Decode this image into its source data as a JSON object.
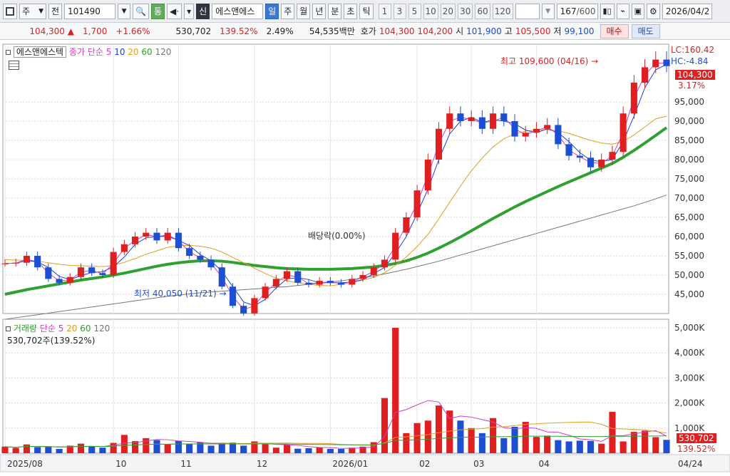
{
  "toolbar": {
    "type_label": "주",
    "code": "101490",
    "compare_label": "통",
    "credit_label": "신",
    "stock_name": "에스앤에스",
    "periods": [
      "일",
      "주",
      "월",
      "년",
      "분",
      "초",
      "틱"
    ],
    "intervals": [
      "1",
      "3",
      "5",
      "10",
      "20",
      "30",
      "60",
      "120"
    ],
    "count": "167",
    "count_total": "/600",
    "date": "2026/04/2"
  },
  "quote": {
    "price": "104,300",
    "change": "1,700",
    "change_pct": "+1.66%",
    "volume": "530,702",
    "volume_ratio": "139.52%",
    "turnover": "2.49%",
    "amount": "54,535백만",
    "bid_label": "호가",
    "ask_price": "104,300",
    "bid_price": "104,200",
    "open_label": "시",
    "open": "101,900",
    "high_label": "고",
    "high": "105,500",
    "low_label": "저",
    "low": "99,100",
    "buy_label": "매수",
    "sell_label": "매도"
  },
  "legend": {
    "name": "에스앤에스텍",
    "price_ma_label": "종가 단순",
    "vol_label": "거래량",
    "vol_ma_label": "단순",
    "ma_periods": [
      "5",
      "10",
      "20",
      "60",
      "120"
    ],
    "volume_value": "530,702주(139.52%)"
  },
  "indicators": {
    "lc": "LC:160.42",
    "hc": "HC:-4.84",
    "current_label": "104,300",
    "current_pct": "3.17%",
    "vol_current": "530,702",
    "vol_pct": "139.52%"
  },
  "annotations": {
    "high": "최고 109,600 (04/16)",
    "low": "최저 40,050 (11/21)",
    "dividend": "배당락(0.00%)"
  },
  "colors": {
    "up": "#e02020",
    "down": "#1f4fd1",
    "ma5": "#d040c0",
    "ma10": "#2040e0",
    "ma20": "#e0a020",
    "ma60": "#30a030",
    "ma120": "#777777"
  },
  "chart_data": {
    "type": "candlestick",
    "x_ticks": [
      "2025/08",
      "10",
      "11",
      "12",
      "2026/01",
      "02",
      "03",
      "04",
      "04/24"
    ],
    "price_axis": {
      "ylim": [
        40000,
        110000
      ],
      "ticks": [
        "45,000",
        "50,000",
        "55,000",
        "60,000",
        "65,000",
        "70,000",
        "75,000",
        "80,000",
        "85,000",
        "90,000",
        "95,000"
      ]
    },
    "volume_axis": {
      "ylim": [
        0,
        5000000
      ],
      "ticks": [
        "1,000K",
        "2,000K",
        "3,000K",
        "4,000K",
        "5,000K"
      ]
    },
    "series": [
      {
        "name": "종가",
        "values": [
          53000,
          53200,
          55000,
          52000,
          49000,
          48000,
          49500,
          52000,
          50500,
          50000,
          56000,
          58000,
          60000,
          61000,
          59000,
          61000,
          57000,
          55000,
          54000,
          52000,
          47000,
          42000,
          40050,
          44000,
          47000,
          49000,
          51000,
          48000,
          47500,
          48500,
          48000,
          47500,
          49000,
          50000,
          52000,
          54000,
          61000,
          65000,
          72000,
          80000,
          88000,
          92000,
          90000,
          91000,
          88000,
          92000,
          90000,
          86000,
          87000,
          88000,
          89000,
          84000,
          81000,
          80500,
          78000,
          80000,
          82000,
          92000,
          100000,
          104000,
          106000,
          104300
        ]
      },
      {
        "name": "20",
        "values": [
          54000,
          53900,
          53800,
          53600,
          53200,
          52800,
          52500,
          52400,
          52300,
          52200,
          52500,
          53300,
          54300,
          55400,
          56300,
          57200,
          57600,
          57700,
          57500,
          57000,
          56000,
          54600,
          53200,
          51800,
          50400,
          49200,
          48500,
          48000,
          47600,
          47300,
          47200,
          47600,
          48100,
          48700,
          49400,
          50600,
          52500,
          54700,
          57400,
          60600,
          64600,
          68900,
          73100,
          77100,
          80400,
          83300,
          85400,
          86700,
          87400,
          87700,
          87800,
          87500,
          86800,
          85900,
          85000,
          84300,
          84000,
          84700,
          86400,
          88500,
          90600,
          91300
        ]
      },
      {
        "name": "60",
        "values": [
          45000,
          45600,
          46200,
          46700,
          47200,
          47700,
          48200,
          48700,
          49100,
          49500,
          50000,
          50500,
          51100,
          51700,
          52300,
          52800,
          53200,
          53500,
          53700,
          53700,
          53600,
          53300,
          52900,
          52500,
          52200,
          51900,
          51700,
          51600,
          51500,
          51500,
          51500,
          51600,
          51700,
          51900,
          52100,
          52500,
          53000,
          53700,
          54600,
          55700,
          57000,
          58400,
          59900,
          61500,
          63100,
          64700,
          66200,
          67700,
          69100,
          70400,
          71700,
          73000,
          74200,
          75400,
          76600,
          77800,
          79000,
          80600,
          82400,
          84300,
          86300,
          88300
        ]
      },
      {
        "name": "120",
        "values": [
          38500,
          38900,
          39300,
          39700,
          40100,
          40500,
          40900,
          41300,
          41700,
          42100,
          42500,
          42900,
          43300,
          43700,
          44100,
          44500,
          44800,
          45100,
          45400,
          45600,
          45800,
          46000,
          46200,
          46400,
          46600,
          46800,
          47000,
          47300,
          47600,
          47900,
          48200,
          48500,
          48900,
          49300,
          49800,
          50300,
          50900,
          51500,
          52200,
          52900,
          53600,
          54400,
          55200,
          56000,
          56800,
          57600,
          58400,
          59200,
          60000,
          60800,
          61600,
          62400,
          63200,
          64000,
          64800,
          65600,
          66400,
          67200,
          68000,
          68900,
          69800,
          70800
        ]
      },
      {
        "name": "거래량",
        "values": [
          260000,
          210000,
          350000,
          240000,
          260000,
          170000,
          300000,
          380000,
          270000,
          220000,
          410000,
          730000,
          480000,
          600000,
          520000,
          360000,
          490000,
          380000,
          440000,
          300000,
          390000,
          420000,
          300000,
          470000,
          360000,
          220000,
          330000,
          180000,
          200000,
          230000,
          170000,
          170000,
          220000,
          260000,
          440000,
          2200000,
          5000000,
          800000,
          1200000,
          1300000,
          1900000,
          1700000,
          1300000,
          1000000,
          800000,
          1400000,
          600000,
          1050000,
          1250000,
          650000,
          700000,
          520000,
          470000,
          500000,
          490000,
          380000,
          1650000,
          470000,
          850000,
          900000,
          640000,
          530702
        ]
      }
    ]
  }
}
